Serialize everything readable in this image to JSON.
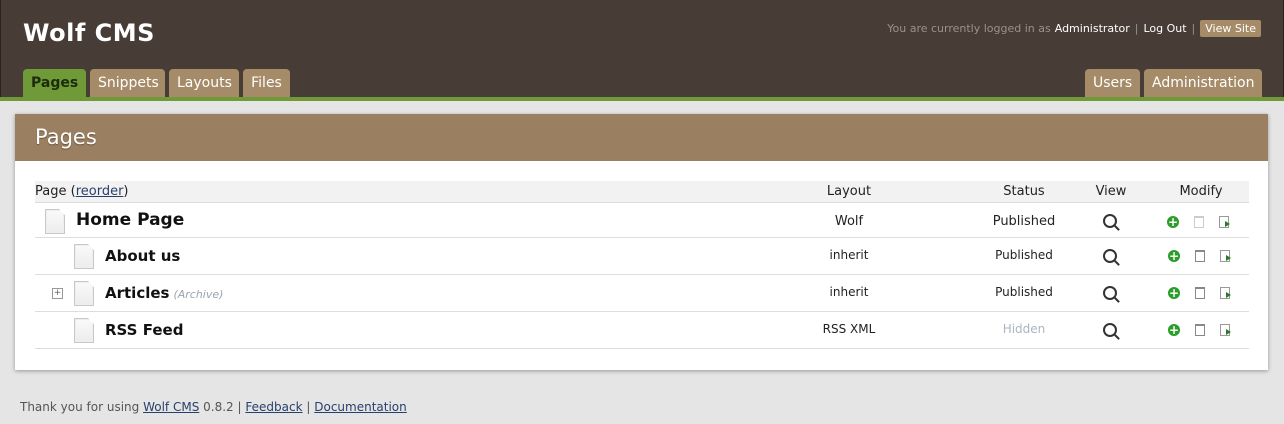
{
  "header": {
    "site_title": "Wolf CMS",
    "logged_in_text": "You are currently logged in as",
    "user": "Administrator",
    "separator": "|",
    "logout": "Log Out",
    "view_site": "View Site"
  },
  "tabs": {
    "pages": "Pages",
    "snippets": "Snippets",
    "layouts": "Layouts",
    "files": "Files",
    "users": "Users",
    "administration": "Administration"
  },
  "panel": {
    "title": "Pages"
  },
  "table": {
    "headers": {
      "page": "Page (",
      "reorder": "reorder",
      "page_close": ")",
      "layout": "Layout",
      "status": "Status",
      "view": "View",
      "modify": "Modify"
    },
    "rows": [
      {
        "title": "Home Page",
        "layout": "Wolf",
        "status": "Published"
      },
      {
        "title": "About us",
        "layout": "inherit",
        "status": "Published"
      },
      {
        "title": "Articles",
        "note": "(Archive)",
        "layout": "inherit",
        "status": "Published",
        "expand": "+"
      },
      {
        "title": "RSS Feed",
        "layout": "RSS XML",
        "status": "Hidden"
      }
    ]
  },
  "footer": {
    "text1": "Thank you for using",
    "wolf": "Wolf CMS",
    "version": "0.8.2",
    "sep": "|",
    "feedback": "Feedback",
    "documentation": "Documentation"
  },
  "colors": {
    "header_bg": "#473c36",
    "accent_green": "#6f9a37",
    "tab_bg": "#a58b68",
    "panel_head": "#9a7f60"
  }
}
